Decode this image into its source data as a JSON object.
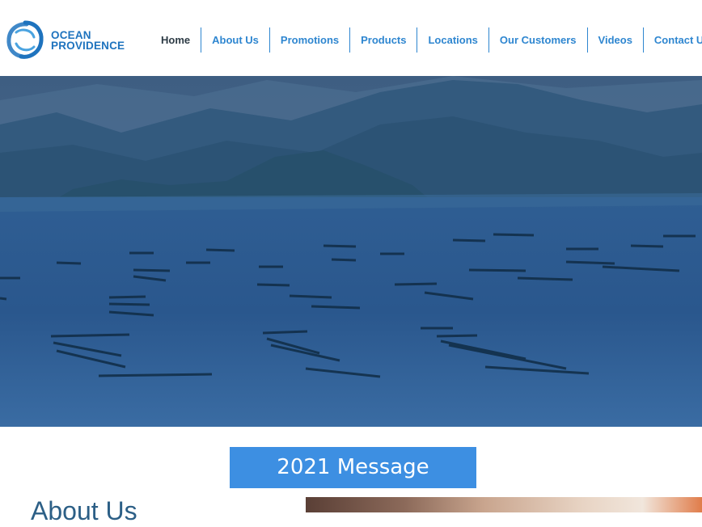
{
  "header": {
    "logo": {
      "line1": "OCEAN",
      "line2": "PROVIDENCE",
      "mark_icon": "ocean-providence-logo-icon"
    },
    "nav": [
      {
        "label": "Home",
        "active": true
      },
      {
        "label": "About Us"
      },
      {
        "label": "Promotions"
      },
      {
        "label": "Products"
      },
      {
        "label": "Locations"
      },
      {
        "label": "Our Customers"
      },
      {
        "label": "Videos"
      },
      {
        "label": "Contact Us"
      }
    ]
  },
  "hero": {
    "image": "aquaculture-bay-with-fish-farm-pens-and-mountains"
  },
  "message_button": {
    "label": "2021 Message"
  },
  "about": {
    "heading": "About Us",
    "image": "sushi-photo"
  },
  "colors": {
    "brand_blue": "#1e73be",
    "nav_blue": "#2e86d0",
    "button_blue": "#3d8fe2",
    "heading": "#2c5f86"
  }
}
